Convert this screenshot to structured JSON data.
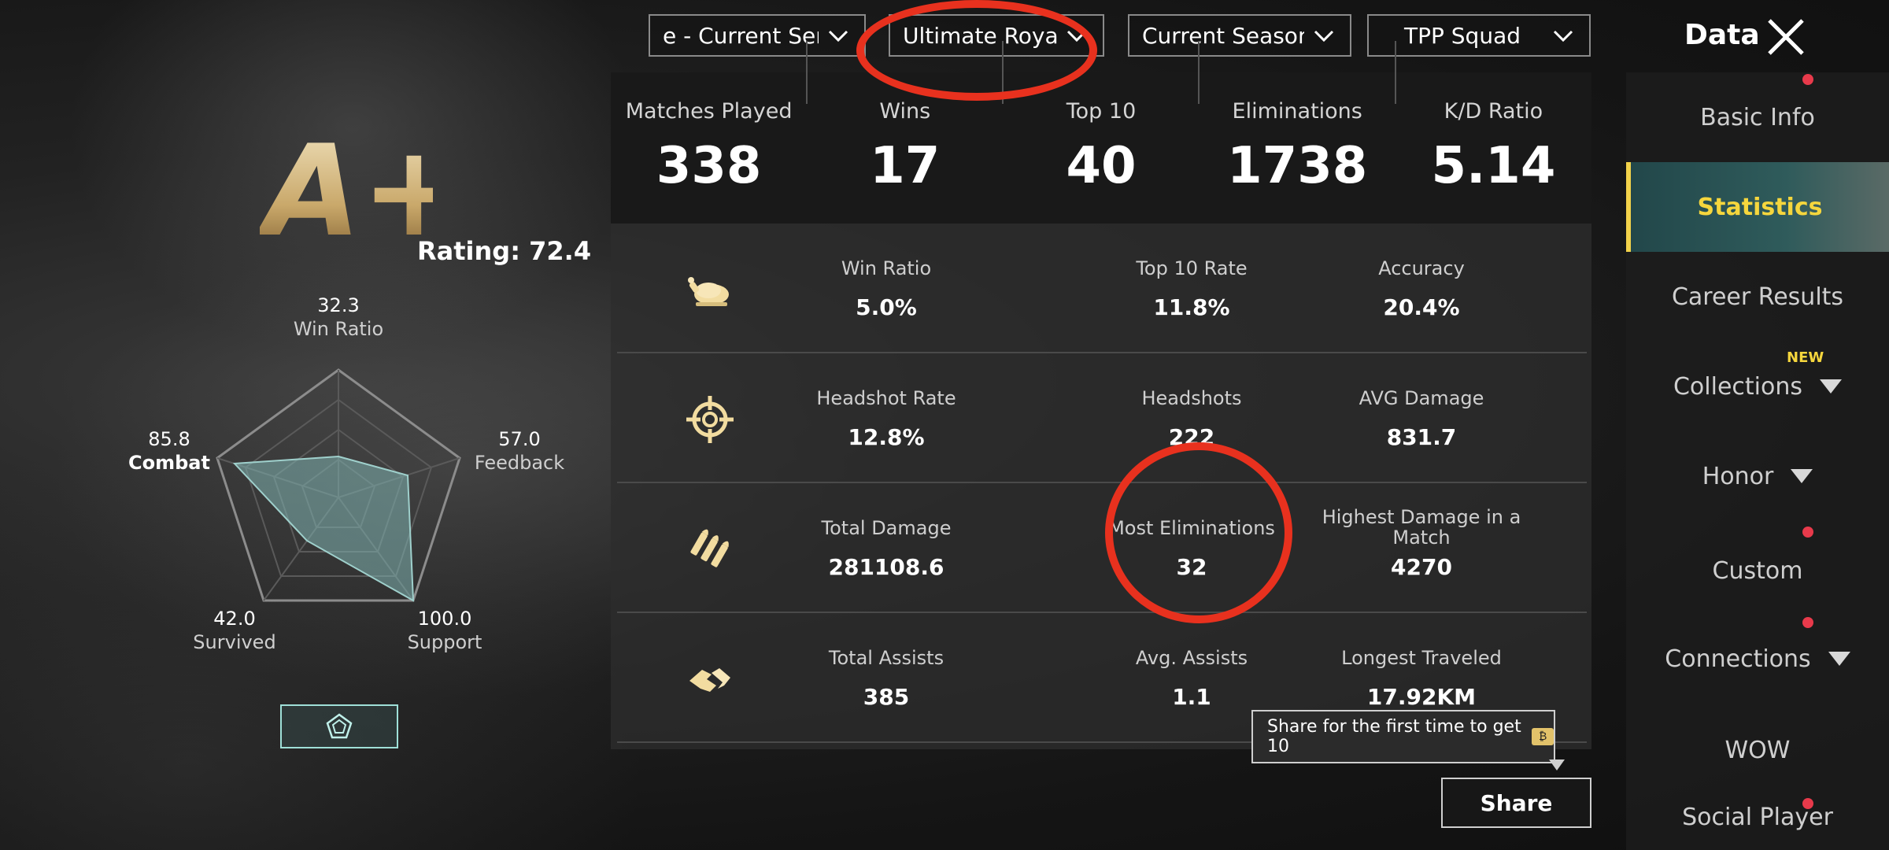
{
  "filters": {
    "server": "e - Current Servi",
    "mode": "Ultimate Royale",
    "season": "Current Season",
    "squad": "TPP Squad"
  },
  "header": {
    "title": "Data"
  },
  "profile": {
    "grade": "A+",
    "rating": "Rating: 72.4",
    "radar": {
      "win_ratio": {
        "value": "32.3",
        "label": "Win Ratio"
      },
      "feedback": {
        "value": "57.0",
        "label": "Feedback"
      },
      "support": {
        "value": "100.0",
        "label": "Support"
      },
      "survived": {
        "value": "42.0",
        "label": "Survived"
      },
      "combat": {
        "value": "85.8",
        "label": "Combat"
      }
    }
  },
  "summary": [
    {
      "label": "Matches Played",
      "value": "338"
    },
    {
      "label": "Wins",
      "value": "17"
    },
    {
      "label": "Top 10",
      "value": "40"
    },
    {
      "label": "Eliminations",
      "value": "1738"
    },
    {
      "label": "K/D Ratio",
      "value": "5.14"
    }
  ],
  "stats": [
    [
      {
        "label": "Win Ratio",
        "value": "5.0%"
      },
      {
        "label": "Top 10 Rate",
        "value": "11.8%"
      },
      {
        "label": "Accuracy",
        "value": "20.4%"
      }
    ],
    [
      {
        "label": "Headshot Rate",
        "value": "12.8%"
      },
      {
        "label": "Headshots",
        "value": "222"
      },
      {
        "label": "AVG Damage",
        "value": "831.7"
      }
    ],
    [
      {
        "label": "Total Damage",
        "value": "281108.6"
      },
      {
        "label": "Most Eliminations",
        "value": "32"
      },
      {
        "label": "Highest Damage in a Match",
        "value": "4270"
      }
    ],
    [
      {
        "label": "Total Assists",
        "value": "385"
      },
      {
        "label": "Avg. Assists",
        "value": "1.1"
      },
      {
        "label": "Longest Traveled",
        "value": "17.92KM"
      }
    ]
  ],
  "share": {
    "tooltip": "Share for the first time to get 10",
    "button": "Share"
  },
  "sidebar": {
    "items": [
      {
        "label": "Basic Info"
      },
      {
        "label": "Statistics"
      },
      {
        "label": "Career Results"
      },
      {
        "label": "Collections"
      },
      {
        "label": "Honor"
      },
      {
        "label": "Custom"
      },
      {
        "label": "Connections"
      },
      {
        "label": "WOW"
      },
      {
        "label": "Social Player"
      }
    ],
    "new_tag": "NEW"
  },
  "colors": {
    "accent": "#f5d63d",
    "annotation": "#e8311e",
    "radar_fill": "#7fb3b0"
  }
}
